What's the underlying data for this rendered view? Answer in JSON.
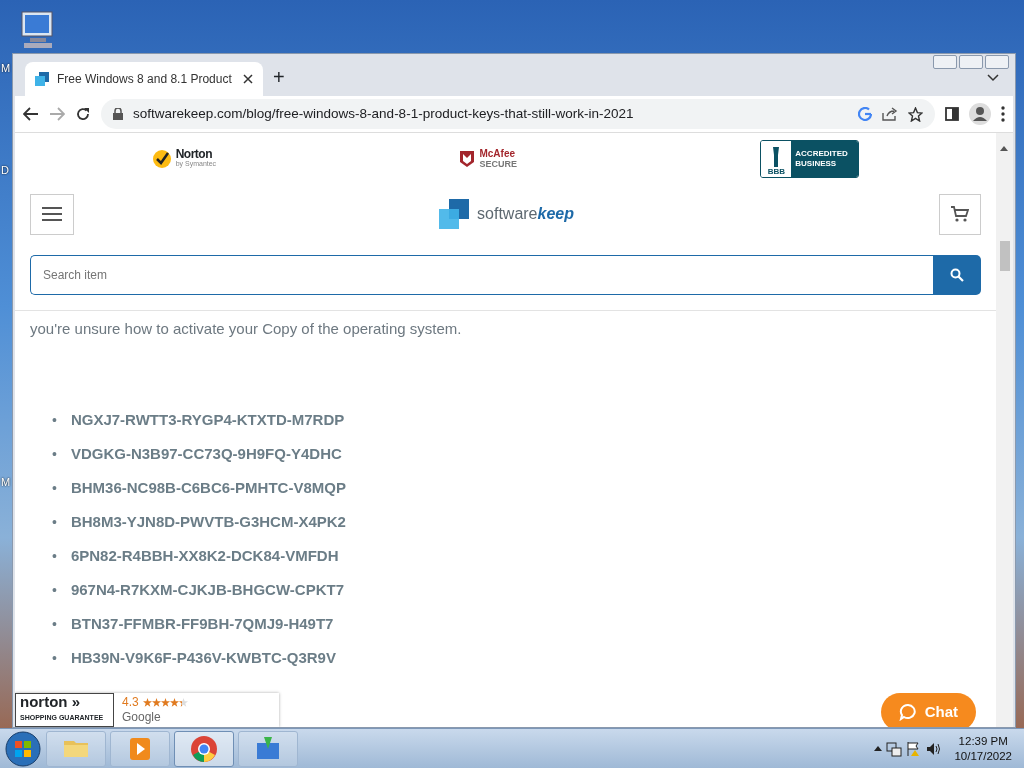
{
  "desktop": {
    "icon_labels": [
      "M",
      "D",
      "M"
    ]
  },
  "browser": {
    "tab": {
      "title": "Free Windows 8 and 8.1 Product",
      "selected": true
    },
    "new_tab": "+",
    "address": "softwarekeep.com/blog/free-windows-8-and-8-1-product-keys-that-still-work-in-2021"
  },
  "page": {
    "badges": [
      {
        "kind": "norton",
        "text": "Norton",
        "sub": "by Symantec"
      },
      {
        "kind": "mcafee",
        "text": "McAfee",
        "sub": "SECURE"
      },
      {
        "kind": "bbb",
        "text": "BBB",
        "sub": "ACCREDITED BUSINESS"
      }
    ],
    "logo": {
      "plain": "software",
      "bold": "keep"
    },
    "search": {
      "placeholder": "Search item"
    },
    "paragraph": "you're unsure how to activate your Copy of the operating system.",
    "keys": [
      {
        "bullet": "•",
        "key": "NGXJ7-RWTT3-RYGP4-KTXTD-M7RDP"
      },
      {
        "bullet": "•",
        "key": "VDGKG-N3B97-CC73Q-9H9FQ-Y4DHC"
      },
      {
        "bullet": "•",
        "key": "BHM36-NC98B-C6BC6-PMHTC-V8MQP"
      },
      {
        "bullet": "•",
        "key": "BH8M3-YJN8D-PWVTB-G3HCM-X4PK2"
      },
      {
        "bullet": "•",
        "key": "6PN82-R4BBH-XX8K2-DCK84-VMFDH"
      },
      {
        "bullet": "•",
        "key": "967N4-R7KXM-CJKJB-BHGCW-CPKT7"
      },
      {
        "bullet": "•",
        "key": "BTN37-FFMBR-FF9BH-7QMJ9-H49T7"
      },
      {
        "bullet": "•",
        "key": "HB39N-V9K6F-P436V-KWBTC-Q3R9V"
      }
    ],
    "seal": {
      "brand": "norton",
      "arrow": "»",
      "sub": "SHOPPING GUARANTEE",
      "rating": "4.3",
      "stars": 4.3,
      "source": "Google"
    },
    "chat": "Chat"
  },
  "taskbar": {
    "apps": [
      {
        "kind": "folder",
        "selected": false
      },
      {
        "kind": "media",
        "selected": false
      },
      {
        "kind": "chrome",
        "selected": true
      },
      {
        "kind": "install",
        "selected": false
      }
    ],
    "time": "12:39 PM",
    "date": "10/17/2022"
  }
}
